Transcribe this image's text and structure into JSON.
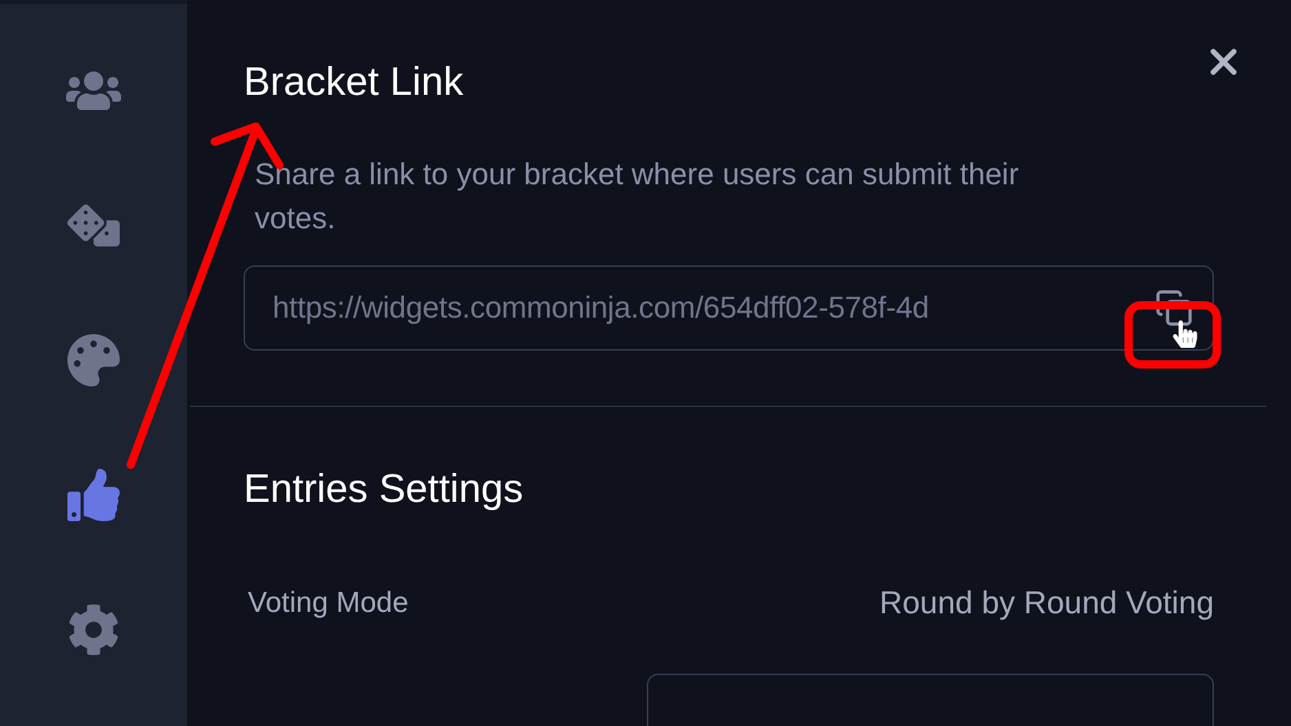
{
  "sidebar": {
    "items": [
      {
        "selected": false
      },
      {
        "selected": false
      },
      {
        "selected": false
      },
      {
        "selected": true
      },
      {
        "selected": false
      }
    ]
  },
  "bracket_link": {
    "title": "Bracket Link",
    "description": "Share a link to your bracket where users can submit their votes.",
    "url": "https://widgets.commoninja.com/654dff02-578f-4d"
  },
  "entries_settings": {
    "title": "Entries Settings",
    "rows": [
      {
        "label": "Voting Mode",
        "value": "Round by Round Voting"
      }
    ]
  }
}
